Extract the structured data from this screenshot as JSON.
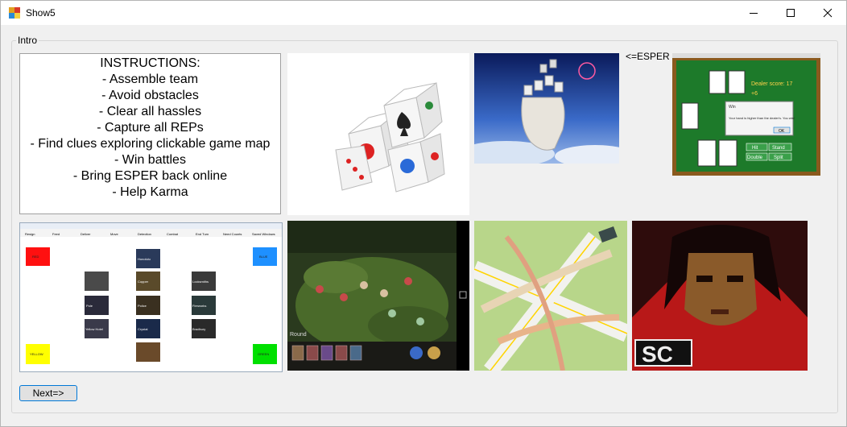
{
  "window": {
    "title": "Show5",
    "minimize_icon": "minimize-icon",
    "maximize_icon": "maximize-icon",
    "close_icon": "close-icon"
  },
  "group": {
    "label": "Intro"
  },
  "instructions": {
    "lines": [
      "INSTRUCTIONS:",
      "- Assemble team",
      "- Avoid obstacles",
      "- Clear all hassles",
      "- Capture all REPs",
      "- Find clues exploring clickable game map",
      "- Win battles",
      "- Bring ESPER back online",
      "- Help Karma"
    ]
  },
  "esper_label": "<=ESPER",
  "next_button": "Next=>",
  "pictures": {
    "blackjack": {
      "dealer_text": "Dealer score: 17",
      "player_text": "+6",
      "dialog_title": "Win",
      "dialog_msg": "Your hand is higher than the dealer's. You win!",
      "dialog_ok": "OK",
      "hit": "Hit",
      "stand": "Stand",
      "double": "Double",
      "split": "Split"
    },
    "map": {
      "menu": [
        "Resign",
        "Feed",
        "Deliver",
        "Move",
        "Detection",
        "Combat",
        "End Turn",
        "Need Counts",
        "Saved Windows"
      ],
      "corners": {
        "red": "RED",
        "blue": "BLUE",
        "yellow": "YELLOW",
        "green": "GREEN"
      },
      "tiles": [
        "Honolulu",
        "Copper",
        "Locksmiths",
        "Pole",
        "Police",
        "Fireworks",
        "Yellow Hotel",
        "Crystal",
        "Bradbury"
      ]
    },
    "game": {
      "status": "Round"
    },
    "portrait": {
      "tag": "SC"
    }
  },
  "colors": {
    "accent": "#0078d7",
    "felt": "#1d7a2a",
    "felt_border": "#8a5a1e"
  }
}
